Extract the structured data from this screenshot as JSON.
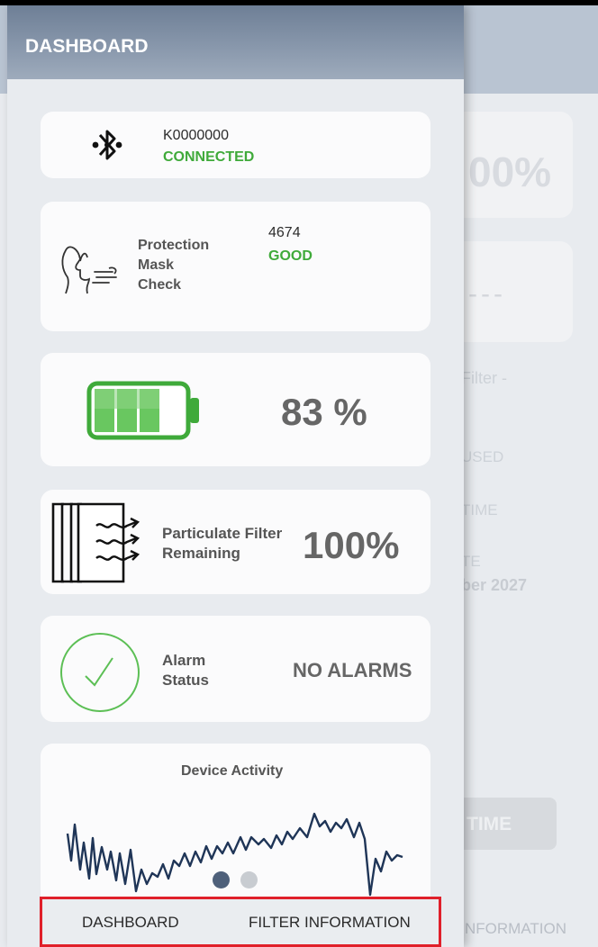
{
  "drawer": {
    "title": "DASHBOARD"
  },
  "bluetooth": {
    "device_id": "K0000000",
    "status": "CONNECTED",
    "icon": "bluetooth-icon"
  },
  "mask_check": {
    "label_line1": "Protection",
    "label_line2": "Mask",
    "label_line3": "Check",
    "value": "4674",
    "status": "GOOD",
    "icon": "breathing-face-icon"
  },
  "battery": {
    "value": "83 %",
    "level": 0.83,
    "icon": "battery-icon"
  },
  "filter": {
    "label_line1": "Particulate Filter",
    "label_line2": "Remaining",
    "value": "100%",
    "icon": "filter-airflow-icon"
  },
  "alarm": {
    "label_line1": "Alarm",
    "label_line2": "Status",
    "value": "NO ALARMS",
    "icon": "check-circle-icon"
  },
  "activity": {
    "title": "Device Activity"
  },
  "pager": {
    "active_index": 0,
    "count": 2
  },
  "tabs": {
    "dashboard": "DASHBOARD",
    "filter_info": "FILTER INFORMATION"
  },
  "background": {
    "percent": "00%",
    "dashes": "---",
    "filter": "Filter -",
    "used": "USED",
    "time": "TIME",
    "te": "TE",
    "date": "ber 2027",
    "button": "TIME",
    "tab": "NFORMATION"
  },
  "colors": {
    "accent_green": "#3faa3a",
    "header": "#7d8ea4",
    "highlight_border": "#e0202a",
    "chart_line": "#1f3557"
  }
}
